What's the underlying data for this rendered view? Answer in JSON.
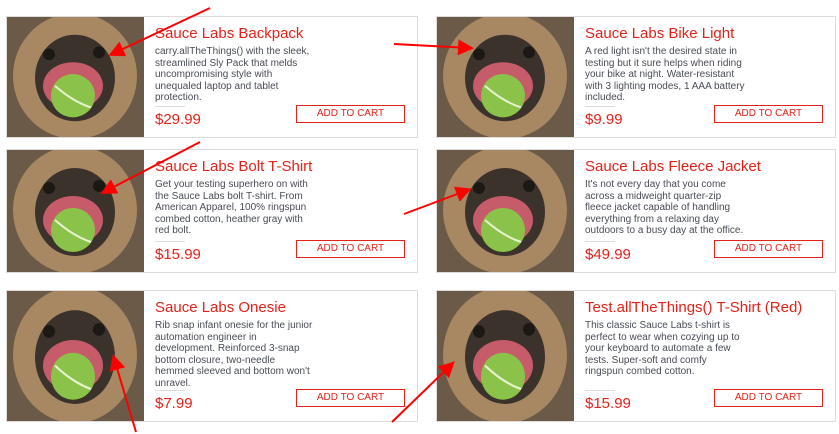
{
  "products": [
    {
      "name": "Sauce Labs Backpack",
      "description": "carry.allTheThings() with the sleek, streamlined Sly Pack that melds uncompromising style with unequaled laptop and tablet protection.",
      "price": "$29.99",
      "button_label": "ADD TO CART"
    },
    {
      "name": "Sauce Labs Bike Light",
      "description": "A red light isn't the desired state in testing but it sure helps when riding your bike at night. Water-resistant with 3 lighting modes, 1 AAA battery included.",
      "price": "$9.99",
      "button_label": "ADD TO CART"
    },
    {
      "name": "Sauce Labs Bolt T-Shirt",
      "description": "Get your testing superhero on with the Sauce Labs bolt T-shirt. From American Apparel, 100% ringspun combed cotton, heather gray with red bolt.",
      "price": "$15.99",
      "button_label": "ADD TO CART"
    },
    {
      "name": "Sauce Labs Fleece Jacket",
      "description": "It's not every day that you come across a midweight quarter-zip fleece jacket capable of handling everything from a relaxing day outdoors to a busy day at the office.",
      "price": "$49.99",
      "button_label": "ADD TO CART"
    },
    {
      "name": "Sauce Labs Onesie",
      "description": "Rib snap infant onesie for the junior automation engineer in development. Reinforced 3-snap bottom closure, two-needle hemmed sleeved and bottom won't unravel.",
      "price": "$7.99",
      "button_label": "ADD TO CART"
    },
    {
      "name": "Test.allTheThings() T-Shirt (Red)",
      "description": "This classic Sauce Labs t-shirt is perfect to wear when cozying up to your keyboard to automate a few tests. Super-soft and comfy ringspun combed cotton.",
      "price": "$15.99",
      "button_label": "ADD TO CART"
    }
  ],
  "theme": {
    "accent": "#e2231a",
    "annotation": "#ff0000"
  },
  "icons": {
    "product_image": "pug-dog-with-tennis-ball-image"
  }
}
